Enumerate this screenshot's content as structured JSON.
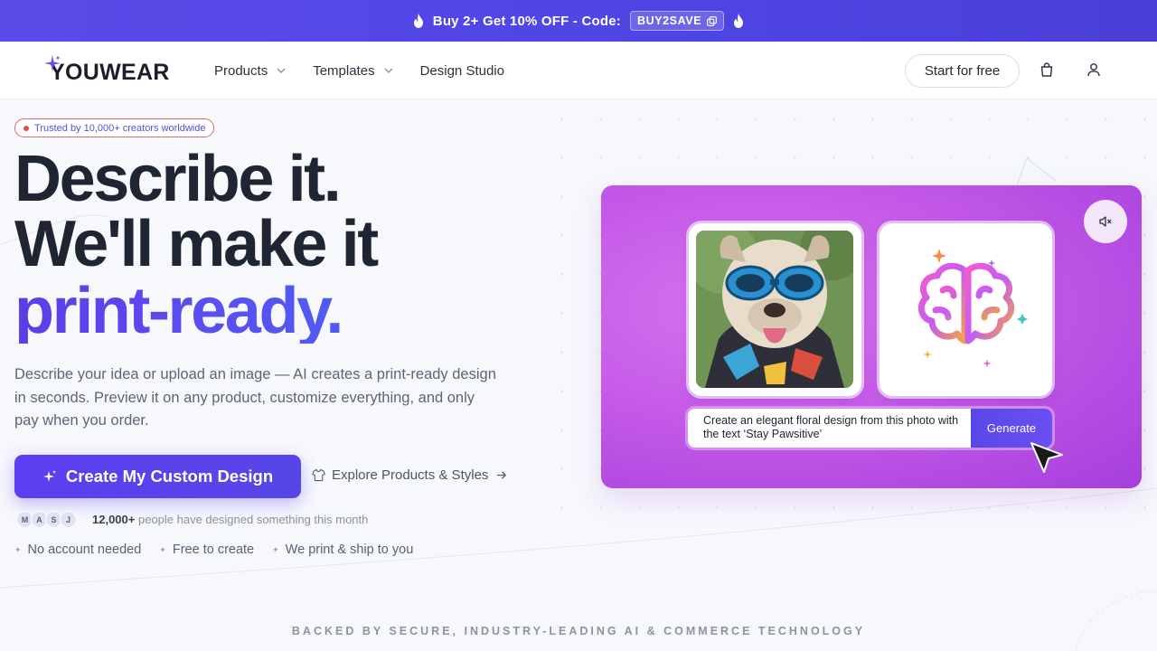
{
  "promo": {
    "text": "Buy 2+ Get 10% OFF - Code:",
    "code": "BUY2SAVE"
  },
  "header": {
    "logo": "YOUWEAR",
    "nav": [
      {
        "label": "Products",
        "has_dropdown": true
      },
      {
        "label": "Templates",
        "has_dropdown": true
      },
      {
        "label": "Design Studio",
        "has_dropdown": false
      }
    ],
    "start_button": "Start for free",
    "icons": [
      "cart-icon",
      "user-icon"
    ]
  },
  "hero": {
    "trust_badge": "Trusted by 10,000+ creators worldwide",
    "headline_1": "Describe it.",
    "headline_2": "We'll make it",
    "headline_3": "print-ready.",
    "lead": "Describe your idea or upload an image — AI creates a print-ready design in seconds. Preview it on any product, customize everything, and only pay when you order.",
    "cta_primary": "Create My Custom Design",
    "cta_secondary": "Explore Products & Styles",
    "avatars": [
      "M",
      "A",
      "S",
      "J"
    ],
    "social_count": "12,000+",
    "social_text": "people have designed something this month",
    "perks": [
      "No account needed",
      "Free to create",
      "We print & ship to you"
    ]
  },
  "demo": {
    "prompt_text": "Create an elegant floral design from this photo with the text ‘Stay Pawsitive’",
    "generate_label": "Generate"
  },
  "footer": {
    "backed_by": "BACKED BY SECURE, INDUSTRY-LEADING AI & COMMERCE TECHNOLOGY"
  },
  "colors": {
    "brand_primary": "#5b3ff0",
    "promo_bg": "#4f46e5",
    "demo_gradient": "#c55ae8",
    "trust_dot": "#e54b4b"
  }
}
